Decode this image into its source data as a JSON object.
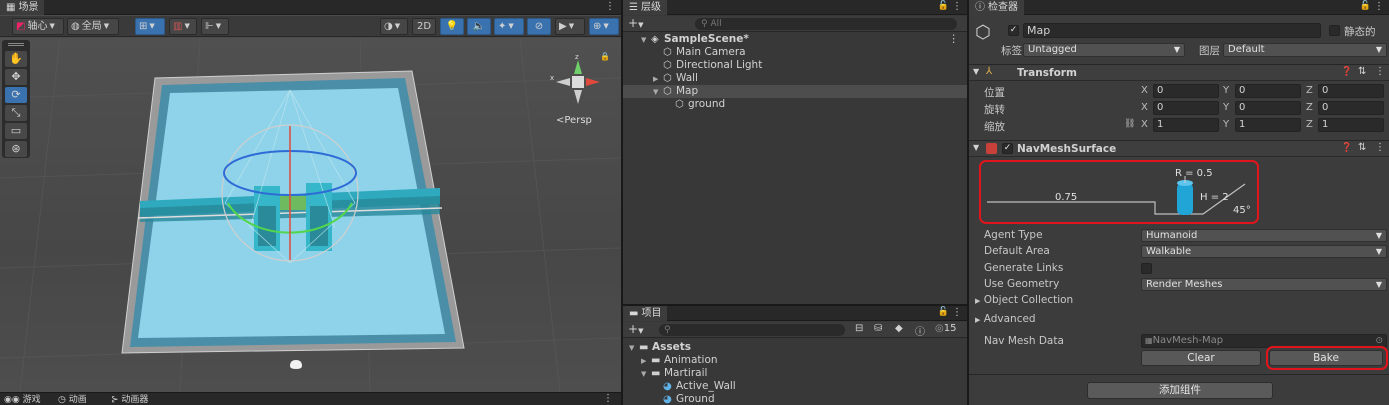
{
  "scene": {
    "tab": "场景",
    "pivot": "轴心",
    "global": "全局",
    "mode2d": "2D",
    "persp": "<Persp"
  },
  "bottom_tabs": [
    "游戏",
    "动画",
    "动画器"
  ],
  "hierarchy": {
    "tab": "层级",
    "add": "+",
    "search_placeholder": "All",
    "items": [
      {
        "label": "SampleScene*",
        "indent": 0,
        "arrow": "▼",
        "icon": "unity-scene-icon"
      },
      {
        "label": "Main Camera",
        "indent": 1,
        "arrow": "",
        "icon": "gameobject-icon"
      },
      {
        "label": "Directional Light",
        "indent": 1,
        "arrow": "",
        "icon": "gameobject-icon"
      },
      {
        "label": "Wall",
        "indent": 1,
        "arrow": "▶",
        "icon": "gameobject-icon"
      },
      {
        "label": "Map",
        "indent": 1,
        "arrow": "▼",
        "icon": "gameobject-icon",
        "selected": true
      },
      {
        "label": "ground",
        "indent": 2,
        "arrow": "",
        "icon": "gameobject-icon"
      }
    ]
  },
  "project": {
    "tab": "项目",
    "add": "+",
    "hidden_count": "15",
    "items": [
      {
        "label": "Assets",
        "indent": 0,
        "arrow": "▼",
        "icon": "folder-open-icon"
      },
      {
        "label": "Animation",
        "indent": 1,
        "arrow": "▶",
        "icon": "folder-icon"
      },
      {
        "label": "Martirail",
        "indent": 1,
        "arrow": "▼",
        "icon": "folder-open-icon"
      },
      {
        "label": "Active_Wall",
        "indent": 2,
        "arrow": "",
        "icon": "material-icon"
      },
      {
        "label": "Ground",
        "indent": 2,
        "arrow": "",
        "icon": "material-icon"
      }
    ]
  },
  "inspector": {
    "tab": "检查器",
    "object_name": "Map",
    "static_label": "静态的",
    "tag_label": "标签",
    "tag_value": "Untagged",
    "layer_label": "图层",
    "layer_value": "Default",
    "transform": {
      "title": "Transform",
      "rows": [
        {
          "label": "位置",
          "x": "0",
          "y": "0",
          "z": "0"
        },
        {
          "label": "旋转",
          "x": "0",
          "y": "0",
          "z": "0"
        },
        {
          "label": "缩放",
          "x": "1",
          "y": "1",
          "z": "1"
        }
      ],
      "axes": [
        "X",
        "Y",
        "Z"
      ]
    },
    "navmesh": {
      "title": "NavMeshSurface",
      "diagram": {
        "radius": "R = 0.5",
        "height": "H = 2",
        "step": "0.75",
        "slope": "45°"
      },
      "agent_type_label": "Agent Type",
      "agent_type_value": "Humanoid",
      "default_area_label": "Default Area",
      "default_area_value": "Walkable",
      "generate_links_label": "Generate Links",
      "use_geometry_label": "Use Geometry",
      "use_geometry_value": "Render Meshes",
      "object_collection_label": "Object Collection",
      "advanced_label": "Advanced",
      "nav_mesh_data_label": "Nav Mesh Data",
      "nav_mesh_data_value": "NavMesh-Map",
      "clear_label": "Clear",
      "bake_label": "Bake"
    },
    "add_component": "添加组件"
  },
  "colors": {
    "accent_blue": "#3a72b0",
    "highlight_red": "#e0141a",
    "navmesh_cyan": "#8fd3ea"
  }
}
